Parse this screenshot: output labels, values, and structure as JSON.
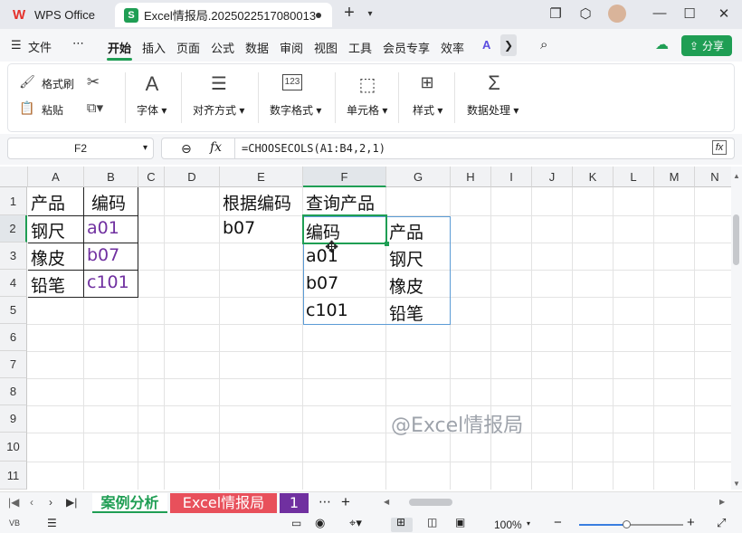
{
  "tabs": {
    "wps": "WPS Office",
    "excel": "Excel情报局.2025022517080013"
  },
  "menu": {
    "file": "文件",
    "more": "⋯",
    "items": [
      "开始",
      "插入",
      "页面",
      "公式",
      "数据",
      "审阅",
      "视图",
      "工具",
      "会员专享",
      "效率"
    ],
    "share": "分享"
  },
  "ribbon": {
    "format_painter": "格式刷",
    "paste": "粘贴",
    "font": "字体",
    "align": "对齐方式",
    "number": "数字格式",
    "cells": "单元格",
    "styles": "样式",
    "data": "数据处理"
  },
  "formula": {
    "cell_ref": "F2",
    "fx": "fx",
    "value": "=CHOOSECOLS(A1:B4,2,1)"
  },
  "columns": [
    "A",
    "B",
    "C",
    "D",
    "E",
    "F",
    "G",
    "H",
    "I",
    "J",
    "K",
    "L",
    "M",
    "N"
  ],
  "rows": [
    "1",
    "2",
    "3",
    "4",
    "5",
    "6",
    "7",
    "8",
    "9",
    "10",
    "11"
  ],
  "cells": {
    "A1": "产品",
    "B1": "编码",
    "A2": "钢尺",
    "B2": "a01",
    "A3": "橡皮",
    "B3": "b07",
    "A4": "铅笔",
    "B4": "c101",
    "E1": "根据编码",
    "F1": "查询产品",
    "E2": "b07",
    "F2": "编码",
    "G2": "产品",
    "F3": "a01",
    "G3": "钢尺",
    "F4": "b07",
    "G4": "橡皮",
    "F5": "c101",
    "G5": "铅笔"
  },
  "watermark": "@Excel情报局",
  "sheets": [
    "案例分析",
    "Excel情报局",
    "1"
  ],
  "status": {
    "zoom": "100%"
  },
  "colors": {
    "accent": "#1f9e54",
    "purple": "#7030a0",
    "select_blue": "#5b9bd5",
    "tab_red": "#e8505b",
    "tab_purple": "#7030a0"
  }
}
